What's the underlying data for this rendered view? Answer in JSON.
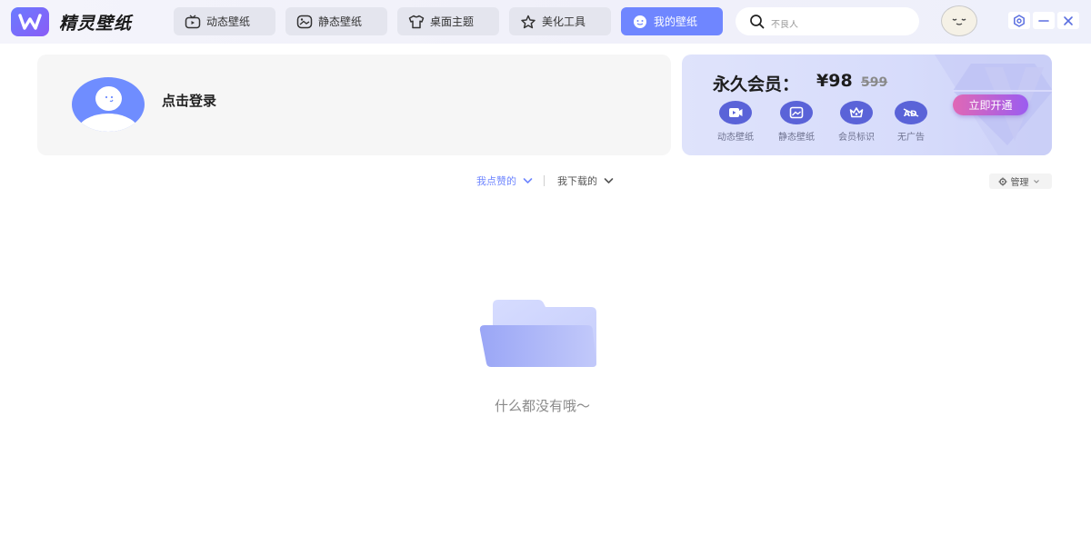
{
  "app": {
    "title": "精灵壁纸"
  },
  "nav": {
    "items": [
      {
        "label": "动态壁纸",
        "icon": "tv-icon",
        "active": false
      },
      {
        "label": "静态壁纸",
        "icon": "picture-icon",
        "active": false
      },
      {
        "label": "桌面主题",
        "icon": "shirt-icon",
        "active": false
      },
      {
        "label": "美化工具",
        "icon": "tools-icon",
        "active": false
      },
      {
        "label": "我的壁纸",
        "icon": "smile-icon",
        "active": true
      }
    ]
  },
  "search": {
    "placeholder": "不良人"
  },
  "window": {
    "controls": [
      "settings-icon",
      "minimize-icon",
      "close-icon"
    ]
  },
  "user": {
    "login_label": "点击登录"
  },
  "vip": {
    "title": "永久会员：",
    "price": "¥98",
    "original_price": "599",
    "features": [
      {
        "label": "动态壁纸",
        "icon": "video-icon"
      },
      {
        "label": "静态壁纸",
        "icon": "image-icon"
      },
      {
        "label": "会员标识",
        "icon": "crown-icon"
      },
      {
        "label": "无广告",
        "icon": "ad-icon"
      }
    ],
    "cta": "立即开通"
  },
  "filters": {
    "liked": "我点赞的",
    "downloaded": "我下载的"
  },
  "manage": {
    "label": "管理"
  },
  "empty": {
    "message": "什么都没有哦～"
  },
  "colors": {
    "accent": "#6f86ff",
    "vip_button": "#b05fe0"
  }
}
